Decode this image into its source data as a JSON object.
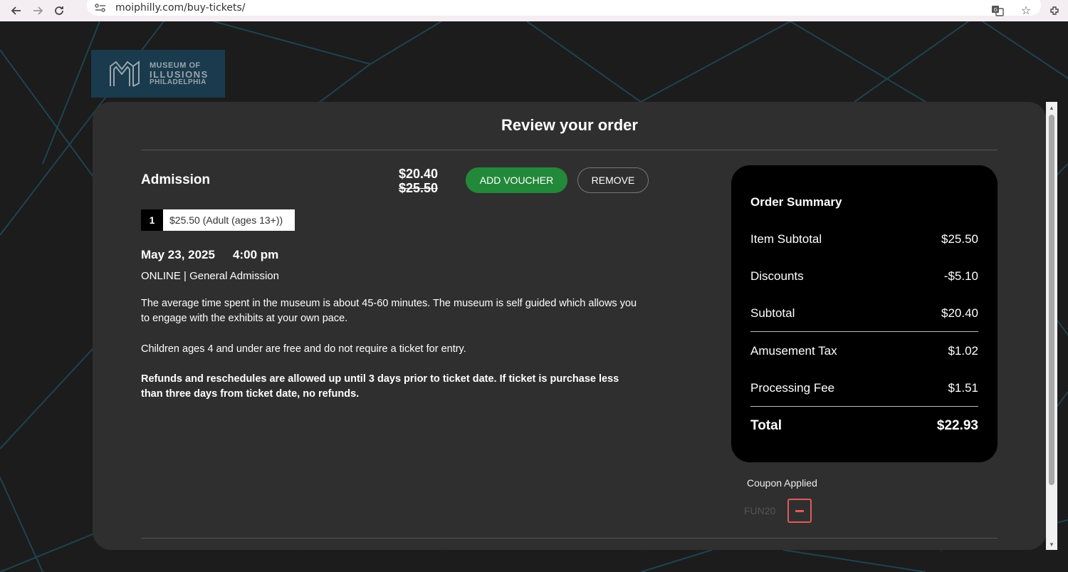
{
  "browser": {
    "url": "moiphilly.com/buy-tickets/",
    "back_icon": "arrow-left-icon",
    "forward_icon": "arrow-right-icon",
    "reload_icon": "reload-icon"
  },
  "logo": {
    "line1": "MUSEUM OF",
    "line2": "ILLUSIONS",
    "line3": "PHILADELPHIA"
  },
  "page": {
    "title": "Review your order"
  },
  "item": {
    "name": "Admission",
    "price_current": "$20.40",
    "price_original": "$25.50",
    "add_voucher_label": "ADD VOUCHER",
    "remove_label": "REMOVE",
    "quantity": "1",
    "ticket_type": "$25.50 (Adult (ages 13+))",
    "date": "May 23, 2025",
    "time": "4:00 pm",
    "type": "ONLINE | General Admission",
    "description": [
      "The average time spent in the museum is about 45-60 minutes. The museum is self guided which allows you to engage with the exhibits at your own pace.",
      "Children ages 4 and under are free and do not require a ticket for entry.",
      "Refunds and reschedules are allowed up until 3 days prior to ticket date. If ticket is purchase less than three days from ticket date, no refunds."
    ]
  },
  "summary": {
    "title": "Order Summary",
    "rows": [
      {
        "label": "Item Subtotal",
        "value": "$25.50"
      },
      {
        "label": "Discounts",
        "value": "-$5.10"
      },
      {
        "label": "Subtotal",
        "value": "$20.40"
      },
      {
        "label": "Amusement Tax",
        "value": "$1.02"
      },
      {
        "label": "Processing Fee",
        "value": "$1.51"
      }
    ],
    "total_label": "Total",
    "total_value": "$22.93"
  },
  "coupon": {
    "label": "Coupon Applied",
    "code": "FUN20"
  },
  "colors": {
    "page_bg": "#1c1c1c",
    "card_bg": "#2f2f2f",
    "summary_bg": "#000000",
    "voucher_button": "#23893a",
    "coupon_remove": "#e05a5a",
    "pattern_line": "#1f4a5a"
  }
}
